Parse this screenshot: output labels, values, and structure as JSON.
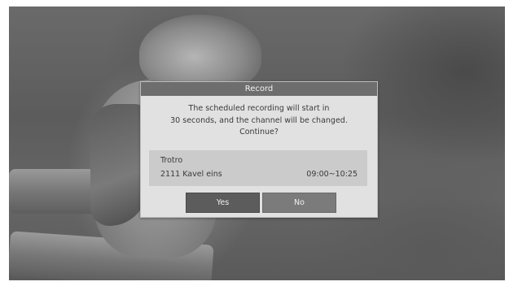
{
  "dialog": {
    "title": "Record",
    "message_lines": [
      "The scheduled recording will start in",
      "30 seconds, and the channel will be changed.",
      "Continue?"
    ],
    "recording": {
      "program_name": "Trotro",
      "channel": "2111 Kavel eins",
      "time_range": "09:00~10:25"
    },
    "buttons": {
      "yes": "Yes",
      "no": "No"
    },
    "focused_button": "yes"
  }
}
